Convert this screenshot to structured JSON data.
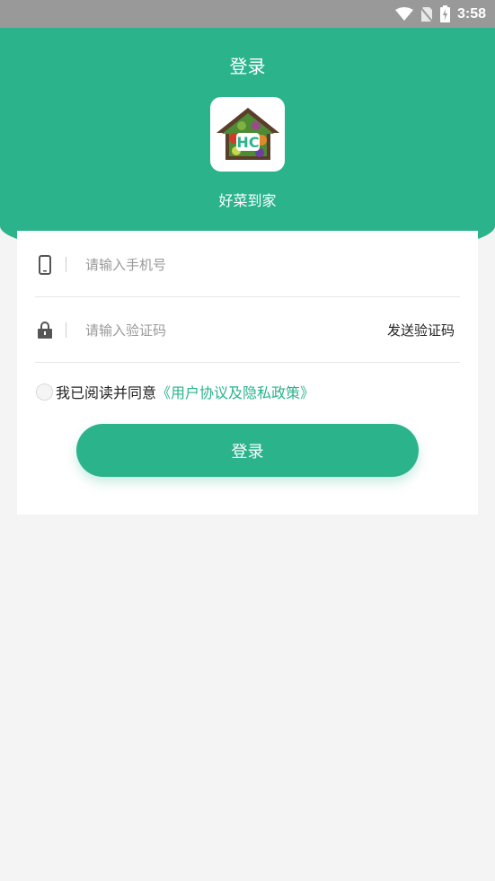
{
  "status_bar": {
    "time": "3:58",
    "icons": [
      "wifi-icon",
      "no-sim-icon",
      "battery-charging-icon"
    ]
  },
  "header": {
    "title": "登录",
    "app_name": "好菜到家",
    "logo_icon": "house-vegetables-logo",
    "logo_text": "HC"
  },
  "form": {
    "phone_placeholder": "请输入手机号",
    "phone_icon": "phone-icon",
    "code_placeholder": "请输入验证码",
    "code_icon": "lock-icon",
    "send_code_label": "发送验证码",
    "agree_text": "我已阅读并同意",
    "agree_link": "《用户协议及隐私政策》",
    "login_label": "登录"
  },
  "colors": {
    "brand": "#2bb38c",
    "status_bar": "#999999",
    "background": "#f4f4f4"
  }
}
